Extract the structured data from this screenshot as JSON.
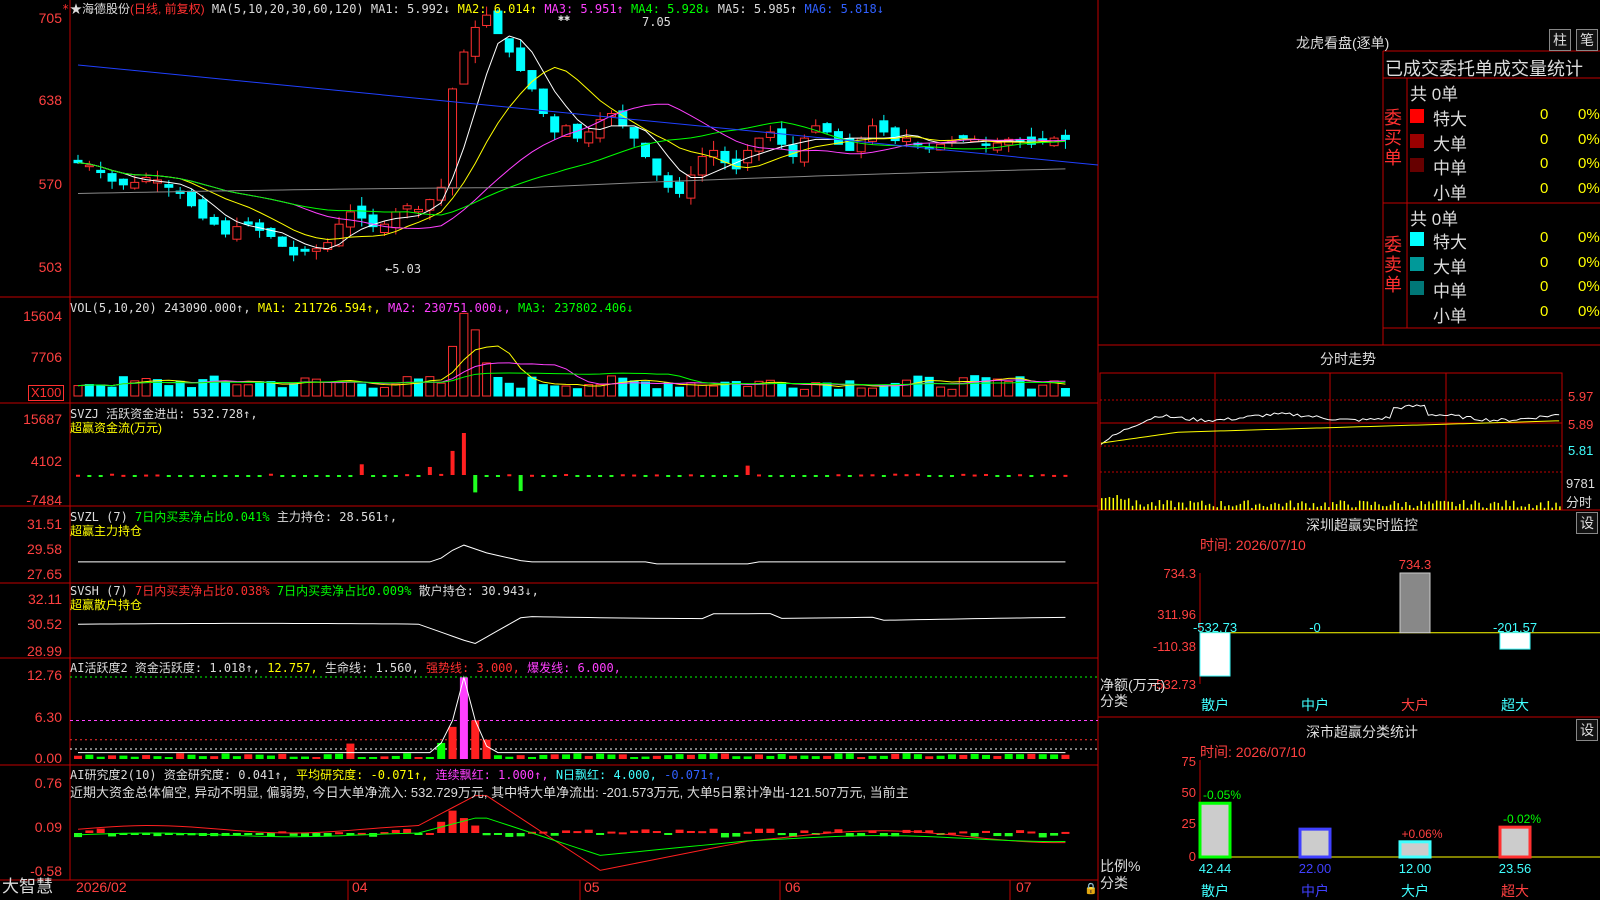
{
  "stock": {
    "name": "★海德股份",
    "period": "(日线, 前复权)",
    "ma_head": "MA(5,10,20,30,60,120)",
    "ma1": "MA1: 5.992↓",
    "ma2": "MA2: 6.014↑",
    "ma3": "MA3: 5.951↑",
    "ma4": "MA4: 5.928↓",
    "ma5": "MA5: 5.985↑",
    "ma6": "MA6: 5.818↓",
    "high_mark": "7.05",
    "low_mark": "←5.03",
    "corner_mark": "*",
    "star_mark": "✱✱"
  },
  "price_axis": [
    "705",
    "638",
    "570",
    "503"
  ],
  "vol": {
    "head": "VOL(5,10,20)",
    "v": "243090.000↑,",
    "ma1": "MA1: 211726.594↑,",
    "ma2": "MA2: 230751.000↓,",
    "ma3": "MA3: 237802.406↓",
    "axis": [
      "15604",
      "7706"
    ],
    "unit": "X100"
  },
  "svzj": {
    "head": "SVZJ  活跃资金进出: 532.728↑,",
    "sub": "超赢资金流(万元)",
    "axis": [
      "15687",
      "4102",
      "-7484"
    ]
  },
  "svzl": {
    "head": "SVZL (7)",
    "p1": "7日内买卖净占比0.041%",
    "p2": "主力持仓: 28.561↑,",
    "sub": "超赢主力持仓",
    "axis": [
      "31.51",
      "29.58",
      "27.65"
    ]
  },
  "svsh": {
    "head": "SVSH (7)",
    "p1": "7日内买卖净占比0.038%",
    "p2": "7日内买卖净占比0.009%",
    "p3": "散户持仓: 30.943↓,",
    "sub": "超赢散户持仓",
    "axis": [
      "32.11",
      "30.52",
      "28.99"
    ]
  },
  "ai1": {
    "head": "AI活跃度2",
    "p1": "资金活跃度: 1.018↑,",
    "p2": "12.757,",
    "p3": "生命线: 1.560,",
    "p4": "强势线: 3.000,",
    "p5": "爆发线: 6.000,",
    "axis": [
      "12.76",
      "6.30",
      "0.00"
    ]
  },
  "ai2": {
    "head": "AI研究度2(10)",
    "p1": "资金研究度: 0.041↑,",
    "p2": "平均研究度: -0.071↑,",
    "p3": "连续飘红: 1.000↑,",
    "p4": "N日飘红: 4.000,",
    "p5": "-0.071↑,",
    "text": "近期大资金总体偏空, 异动不明显, 偏弱势, 今日大单净流入: 532.729万元, 其中特大单净流出: -201.573万元, 大单5日累计净出-121.507万元, 当前主",
    "axis": [
      "0.76",
      "0.09",
      "-0.58"
    ]
  },
  "xaxis": [
    "2026/02",
    "04",
    "05",
    "06",
    "07"
  ],
  "brand": "大智慧",
  "lhb": {
    "title": "龙虎看盘(逐单)",
    "btn1": "柱",
    "btn2": "笔",
    "tabs": "已成交委托单成交量统计",
    "buy_label": "委买单",
    "sell_label": "委卖单",
    "buy_total": "共 0单",
    "sell_total": "共 0单",
    "buy_rows": [
      {
        "name": "特大",
        "n": "0",
        "p": "0%",
        "color": "#ff0000"
      },
      {
        "name": "大单",
        "n": "0",
        "p": "0%",
        "color": "#990000"
      },
      {
        "name": "中单",
        "n": "0",
        "p": "0%",
        "color": "#660000"
      },
      {
        "name": "小单",
        "n": "0",
        "p": "0%",
        "color": "#000000"
      }
    ],
    "sell_rows": [
      {
        "name": "特大",
        "n": "0",
        "p": "0%",
        "color": "#00ffff"
      },
      {
        "name": "大单",
        "n": "0",
        "p": "0%",
        "color": "#009999"
      },
      {
        "name": "中单",
        "n": "0",
        "p": "0%",
        "color": "#007777"
      },
      {
        "name": "小单",
        "n": "0",
        "p": "0%",
        "color": "#000000"
      }
    ]
  },
  "fenshi": {
    "title": "分时走势",
    "axis": [
      "5.97",
      "5.89",
      "5.81",
      "9781",
      "分时"
    ]
  },
  "monitor": {
    "title": "深圳超赢实时监控",
    "btn": "设",
    "time": "时间: 2026/07/10",
    "axis": [
      "734.3",
      "311.96",
      "-110.38",
      "-532.73"
    ],
    "ylabel": "净额(万元)",
    "xlabel": "分类",
    "cats": [
      "散户",
      "中户",
      "大户",
      "超大"
    ],
    "values": [
      -532.73,
      0,
      734.3,
      -201.57
    ],
    "value_labels": [
      "-532.73",
      "-0",
      "734.3",
      "-201.57"
    ]
  },
  "stats": {
    "title": "深市超赢分类统计",
    "btn": "设",
    "time": "时间: 2026/07/10",
    "axis": [
      "75",
      "50",
      "25",
      "0"
    ],
    "ylabel": "比例%",
    "xlabel": "分类",
    "cats": [
      "散户",
      "中户",
      "大户",
      "超大"
    ],
    "values": [
      42.44,
      22.0,
      12.0,
      23.56
    ],
    "value_labels": [
      "42.44",
      "22.00",
      "12.00",
      "23.56"
    ],
    "changes": [
      "-0.05%",
      "",
      "+0.06%",
      "-0.02%"
    ]
  }
}
